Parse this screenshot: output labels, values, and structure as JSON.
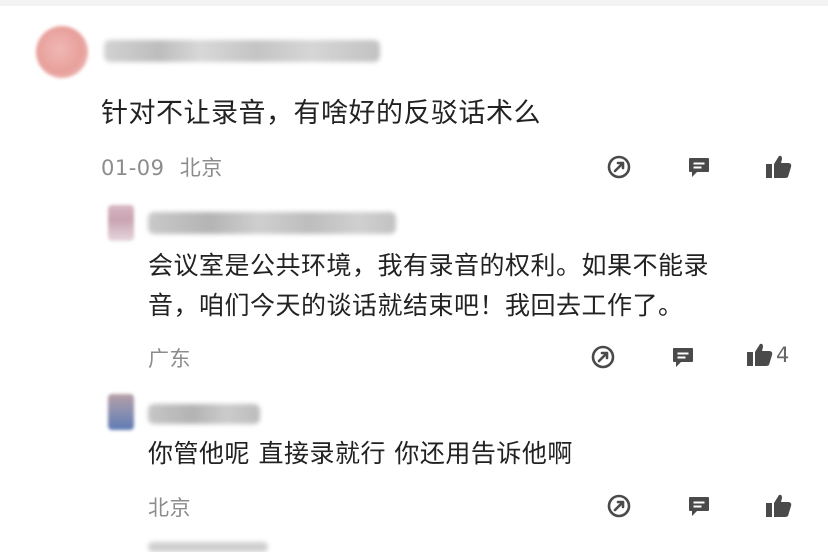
{
  "comments": [
    {
      "author": "user_a",
      "text": "针对不让录音，有啥好的反驳话术么",
      "date": "01-09",
      "location": "北京",
      "likes": ""
    },
    {
      "author": "user_b",
      "text_line1": "会议室是公共环境，我有录音的权利。如果不能录",
      "text_line2": "音，咱们今天的谈话就结束吧！我回去工作了。",
      "location": "广东",
      "likes": "4"
    },
    {
      "author": "user_c",
      "text": "你管他呢 直接录就行 你还用告诉他啊",
      "location": "北京",
      "likes": ""
    }
  ],
  "icons": [
    "share-icon",
    "reply-icon",
    "like-icon"
  ],
  "colors": {
    "icon": "#4a4a4a",
    "meta": "#8c8c8c",
    "text": "#222222"
  }
}
